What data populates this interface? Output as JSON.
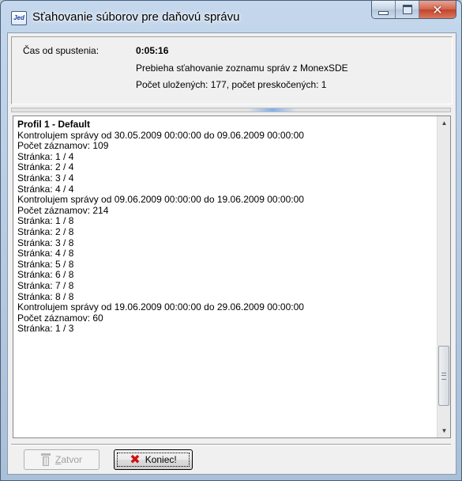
{
  "window": {
    "title": "Sťahovanie súborov pre daňovú správu",
    "app_icon_text": "Jed"
  },
  "info": {
    "elapsed_label": "Čas od spustenia:",
    "elapsed_value": "0:05:16",
    "status": "Prebieha sťahovanie zoznamu správ z MonexSDE",
    "counts": "Počet uložených: 177, počet preskočených: 1"
  },
  "log": {
    "lines": [
      {
        "text": "Profil 1 - Default",
        "bold": true
      },
      {
        "text": "Kontrolujem správy od 30.05.2009 00:00:00 do 09.06.2009 00:00:00"
      },
      {
        "text": "Počet záznamov: 109"
      },
      {
        "text": "Stránka: 1 / 4"
      },
      {
        "text": "Stránka: 2 / 4"
      },
      {
        "text": "Stránka: 3 / 4"
      },
      {
        "text": "Stránka: 4 / 4"
      },
      {
        "text": "Kontrolujem správy od 09.06.2009 00:00:00 do 19.06.2009 00:00:00"
      },
      {
        "text": "Počet záznamov: 214"
      },
      {
        "text": "Stránka: 1 / 8"
      },
      {
        "text": "Stránka: 2 / 8"
      },
      {
        "text": "Stránka: 3 / 8"
      },
      {
        "text": "Stránka: 4 / 8"
      },
      {
        "text": "Stránka: 5 / 8"
      },
      {
        "text": "Stránka: 6 / 8"
      },
      {
        "text": "Stránka: 7 / 8"
      },
      {
        "text": "Stránka: 8 / 8"
      },
      {
        "text": "Kontrolujem správy od 19.06.2009 00:00:00 do 29.06.2009 00:00:00"
      },
      {
        "text": "Počet záznamov: 60"
      },
      {
        "text": "Stránka: 1 / 3"
      }
    ]
  },
  "buttons": {
    "close_mnemonic": "Z",
    "close_rest": "atvor",
    "end_label": "Koniec!"
  },
  "icons": {
    "app": "app-icon",
    "minimize": "minimize-icon",
    "maximize": "maximize-icon",
    "close": "close-icon",
    "close_button": "bin-icon",
    "end_button": "x-icon"
  },
  "colors": {
    "title_bar": "#b4c9e2",
    "close_button": "#c8482f",
    "end_icon": "#d01010"
  }
}
